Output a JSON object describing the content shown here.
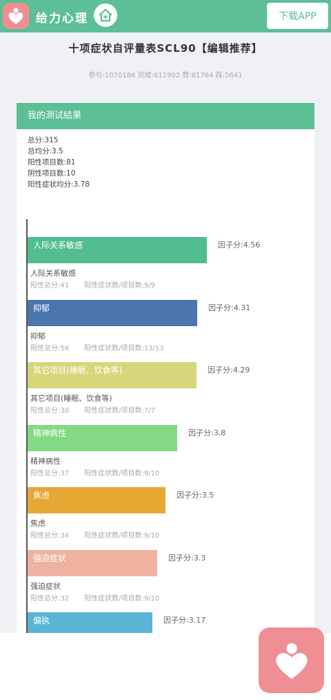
{
  "header": {
    "brand": "给力心理",
    "download_label": "下载APP"
  },
  "page": {
    "title": "十项症状自评量表SCL90【编辑推荐】",
    "stats": "参与:1070186 完成:611902 赞:81764 踩:5641"
  },
  "result": {
    "heading": "我的测试结果",
    "summary": [
      "总分:315",
      "总均分:3.5",
      "阳性项目数:81",
      "阴性项目数:10",
      "阳性症状均分:3.78"
    ]
  },
  "chart_data": {
    "type": "bar",
    "categories": [
      "人际关系敏感",
      "抑郁",
      "其它项目(睡眠、饮食等)",
      "精神病性",
      "焦虑",
      "强迫症状",
      "偏执"
    ],
    "values": [
      4.56,
      4.31,
      4.29,
      3.8,
      3.5,
      3.3,
      3.17
    ],
    "score_labels": [
      "因子分:4.56",
      "因子分:4.31",
      "因子分:4.29",
      "因子分:3.8",
      "因子分:3.5",
      "因子分:3.3",
      "因子分:3.17"
    ],
    "positive_totals": [
      "阳性总分:41",
      "阳性总分:56",
      "阳性总分:30",
      "阳性总分:37",
      "阳性总分:34",
      "阳性总分:32",
      ""
    ],
    "positive_ratios": [
      "阳性症状数/项目数:9/9",
      "阳性症状数/项目数:13/13",
      "阳性症状数/项目数:7/7",
      "阳性症状数/项目数:9/10",
      "阳性症状数/项目数:9/10",
      "阳性症状数/项目数:9/10",
      ""
    ],
    "colors": [
      "#52bd8f",
      "#4a75ad",
      "#d8d67a",
      "#84d984",
      "#e6a733",
      "#f0b2a0",
      "#5bb4d6"
    ]
  }
}
